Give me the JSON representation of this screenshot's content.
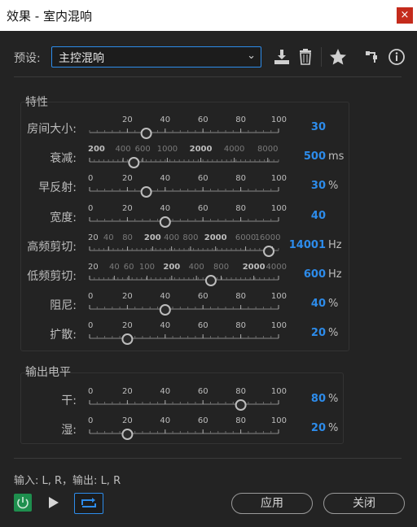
{
  "window": {
    "title": "效果 - 室内混响",
    "close_glyph": "×"
  },
  "preset": {
    "label": "预设:",
    "value": "主控混响"
  },
  "icons": [
    "save-preset-icon",
    "delete-icon",
    "favorite-star-icon",
    "routing-icon",
    "info-icon"
  ],
  "characteristics": {
    "title": "特性",
    "params": [
      {
        "name": "房间大小:",
        "value": "30",
        "unit": "",
        "scale": "linear",
        "min": 0,
        "max": 100,
        "ticks": [
          {
            "t": "20",
            "v": 20
          },
          {
            "t": "40",
            "v": 40
          },
          {
            "t": "60",
            "v": 60
          },
          {
            "t": "80",
            "v": 80
          },
          {
            "t": "100",
            "v": 100
          }
        ],
        "knob": 30
      },
      {
        "name": "衰减:",
        "value": "500",
        "unit": "ms",
        "scale": "log",
        "min": 200,
        "max": 10000,
        "ticks": [
          {
            "t": "200",
            "v": 200,
            "s": "bold"
          },
          {
            "t": "400",
            "v": 400,
            "s": "dim"
          },
          {
            "t": "600",
            "v": 600,
            "s": "dim"
          },
          {
            "t": "1000",
            "v": 1000,
            "s": "dim"
          },
          {
            "t": "2000",
            "v": 2000,
            "s": "bold"
          },
          {
            "t": "4000",
            "v": 4000,
            "s": "dim"
          },
          {
            "t": "8000",
            "v": 8000,
            "s": "dim"
          }
        ],
        "knob": 500
      },
      {
        "name": "早反射:",
        "value": "30",
        "unit": "%",
        "scale": "linear",
        "min": 0,
        "max": 100,
        "ticks": [
          {
            "t": "0",
            "v": 0
          },
          {
            "t": "20",
            "v": 20
          },
          {
            "t": "40",
            "v": 40
          },
          {
            "t": "60",
            "v": 60
          },
          {
            "t": "80",
            "v": 80
          },
          {
            "t": "100",
            "v": 100
          }
        ],
        "knob": 30
      },
      {
        "name": "宽度:",
        "value": "40",
        "unit": "",
        "scale": "linear",
        "min": 0,
        "max": 100,
        "ticks": [
          {
            "t": "0",
            "v": 0
          },
          {
            "t": "20",
            "v": 20
          },
          {
            "t": "40",
            "v": 40
          },
          {
            "t": "60",
            "v": 60
          },
          {
            "t": "80",
            "v": 80
          },
          {
            "t": "100",
            "v": 100
          }
        ],
        "knob": 40
      },
      {
        "name": "高频剪切:",
        "value": "14001",
        "unit": "Hz",
        "scale": "log",
        "min": 20,
        "max": 20000,
        "ticks": [
          {
            "t": "20",
            "v": 20
          },
          {
            "t": "40",
            "v": 40,
            "s": "dim"
          },
          {
            "t": "80",
            "v": 80,
            "s": "dim"
          },
          {
            "t": "200",
            "v": 200,
            "s": "bold"
          },
          {
            "t": "400",
            "v": 400,
            "s": "dim"
          },
          {
            "t": "800",
            "v": 800,
            "s": "dim"
          },
          {
            "t": "2000",
            "v": 2000,
            "s": "bold"
          },
          {
            "t": "6000",
            "v": 6000,
            "s": "dim"
          },
          {
            "t": "16000",
            "v": 16000,
            "s": "dim"
          }
        ],
        "knob": 14001
      },
      {
        "name": "低频剪切:",
        "value": "600",
        "unit": "Hz",
        "scale": "log",
        "min": 20,
        "max": 4000,
        "ticks": [
          {
            "t": "20",
            "v": 20
          },
          {
            "t": "40",
            "v": 40,
            "s": "dim"
          },
          {
            "t": "60",
            "v": 60,
            "s": "dim"
          },
          {
            "t": "100",
            "v": 100,
            "s": "dim"
          },
          {
            "t": "200",
            "v": 200,
            "s": "bold"
          },
          {
            "t": "400",
            "v": 400,
            "s": "dim"
          },
          {
            "t": "800",
            "v": 800,
            "s": "dim"
          },
          {
            "t": "2000",
            "v": 2000,
            "s": "bold"
          },
          {
            "t": "4000",
            "v": 4000,
            "s": "dim"
          }
        ],
        "knob": 600
      },
      {
        "name": "阻尼:",
        "value": "40",
        "unit": "%",
        "scale": "linear",
        "min": 0,
        "max": 100,
        "ticks": [
          {
            "t": "0",
            "v": 0
          },
          {
            "t": "20",
            "v": 20
          },
          {
            "t": "40",
            "v": 40
          },
          {
            "t": "60",
            "v": 60
          },
          {
            "t": "80",
            "v": 80
          },
          {
            "t": "100",
            "v": 100
          }
        ],
        "knob": 40
      },
      {
        "name": "扩散:",
        "value": "20",
        "unit": "%",
        "scale": "linear",
        "min": 0,
        "max": 100,
        "ticks": [
          {
            "t": "0",
            "v": 0
          },
          {
            "t": "20",
            "v": 20
          },
          {
            "t": "40",
            "v": 40
          },
          {
            "t": "60",
            "v": 60
          },
          {
            "t": "80",
            "v": 80
          },
          {
            "t": "100",
            "v": 100
          }
        ],
        "knob": 20
      }
    ]
  },
  "output": {
    "title": "输出电平",
    "params": [
      {
        "name": "干:",
        "value": "80",
        "unit": "%",
        "scale": "linear",
        "min": 0,
        "max": 100,
        "ticks": [
          {
            "t": "0",
            "v": 0
          },
          {
            "t": "20",
            "v": 20
          },
          {
            "t": "40",
            "v": 40
          },
          {
            "t": "60",
            "v": 60
          },
          {
            "t": "80",
            "v": 80
          },
          {
            "t": "100",
            "v": 100
          }
        ],
        "knob": 80
      },
      {
        "name": "湿:",
        "value": "20",
        "unit": "%",
        "scale": "linear",
        "min": 0,
        "max": 100,
        "ticks": [
          {
            "t": "0",
            "v": 0
          },
          {
            "t": "20",
            "v": 20
          },
          {
            "t": "40",
            "v": 40
          },
          {
            "t": "60",
            "v": 60
          },
          {
            "t": "80",
            "v": 80
          },
          {
            "t": "100",
            "v": 100
          }
        ],
        "knob": 20
      }
    ]
  },
  "io": "输入: L, R，输出: L, R",
  "buttons": {
    "apply": "应用",
    "close": "关闭"
  },
  "colors": {
    "accent": "#2d8ceb",
    "power": "#1e8f4e",
    "title_close": "#c42b1c"
  }
}
